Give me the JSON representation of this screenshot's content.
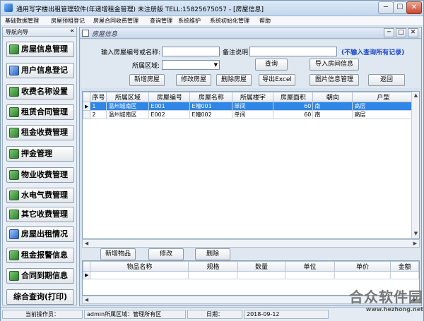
{
  "window": {
    "title": "通用写字楼出租管理软件(年递增租金管理) 未注册版 TELL:15825675057  - [房屋信息]",
    "min_label": "─",
    "max_label": "☐",
    "close_label": "✕"
  },
  "menubar": [
    "基础数据管理",
    "房屋预租登记",
    "房屋合同收费管理",
    "查询管理",
    "系统维护",
    "系统初始化管理",
    "帮助"
  ],
  "nav": {
    "title": "导航向导",
    "collapse": "«",
    "items": [
      "房屋信息管理",
      "用户信息登记",
      "收费名称设置",
      "租赁合同管理",
      "租金收费管理",
      "押金管理",
      "物业收费管理",
      "水电气费管理",
      "其它收费管理",
      "房屋出租情况",
      "租金报警信息",
      "合同到期信息"
    ],
    "query": "综合查询(打印)"
  },
  "inner": {
    "title": "房屋信息",
    "btn_min": "─",
    "btn_restore": "□",
    "btn_close": "✕"
  },
  "form": {
    "label_code": "输入房屋编号或名称:",
    "code_value": "",
    "label_remark": "备注说明",
    "remark_value": "",
    "hint": "(不输入查询所有记录)",
    "label_area": "所属区域:",
    "area_value": "",
    "btn_query": "查询",
    "btn_import": "导入房间信息",
    "btn_add": "新增房屋",
    "btn_edit": "修改房屋",
    "btn_delete": "删除房屋",
    "btn_export": "导出Excel",
    "btn_image": "图片信息管理",
    "btn_back": "返回"
  },
  "grid": {
    "columns": [
      "序号",
      "所属区域",
      "房屋编号",
      "房屋名称",
      "所属楼宇",
      "房屋面积",
      "朝向",
      "户型"
    ],
    "rows": [
      {
        "indicator": "▶",
        "no": "1",
        "area": "温州城南区",
        "code": "E001",
        "name": "E幢001",
        "building": "单间",
        "size": "60",
        "orient": "南",
        "type": "高层"
      },
      {
        "indicator": "",
        "no": "2",
        "area": "温州城南区",
        "code": "E002",
        "name": "E幢002",
        "building": "单间",
        "size": "60",
        "orient": "南",
        "type": "高层"
      }
    ]
  },
  "sub": {
    "btn_add": "新增物品",
    "btn_edit": "修改",
    "btn_delete": "删除",
    "columns": [
      "物品名称",
      "规格",
      "数量",
      "单位",
      "单价",
      "金额"
    ],
    "indicator": "▶"
  },
  "status": {
    "label_operator": "当前操作员：",
    "operator": "admin所属区域：管理所有区",
    "label_date": "日期：",
    "date": "2018-09-12"
  },
  "watermark": {
    "name": "合众软件园",
    "url": "www.hezhong.net"
  }
}
